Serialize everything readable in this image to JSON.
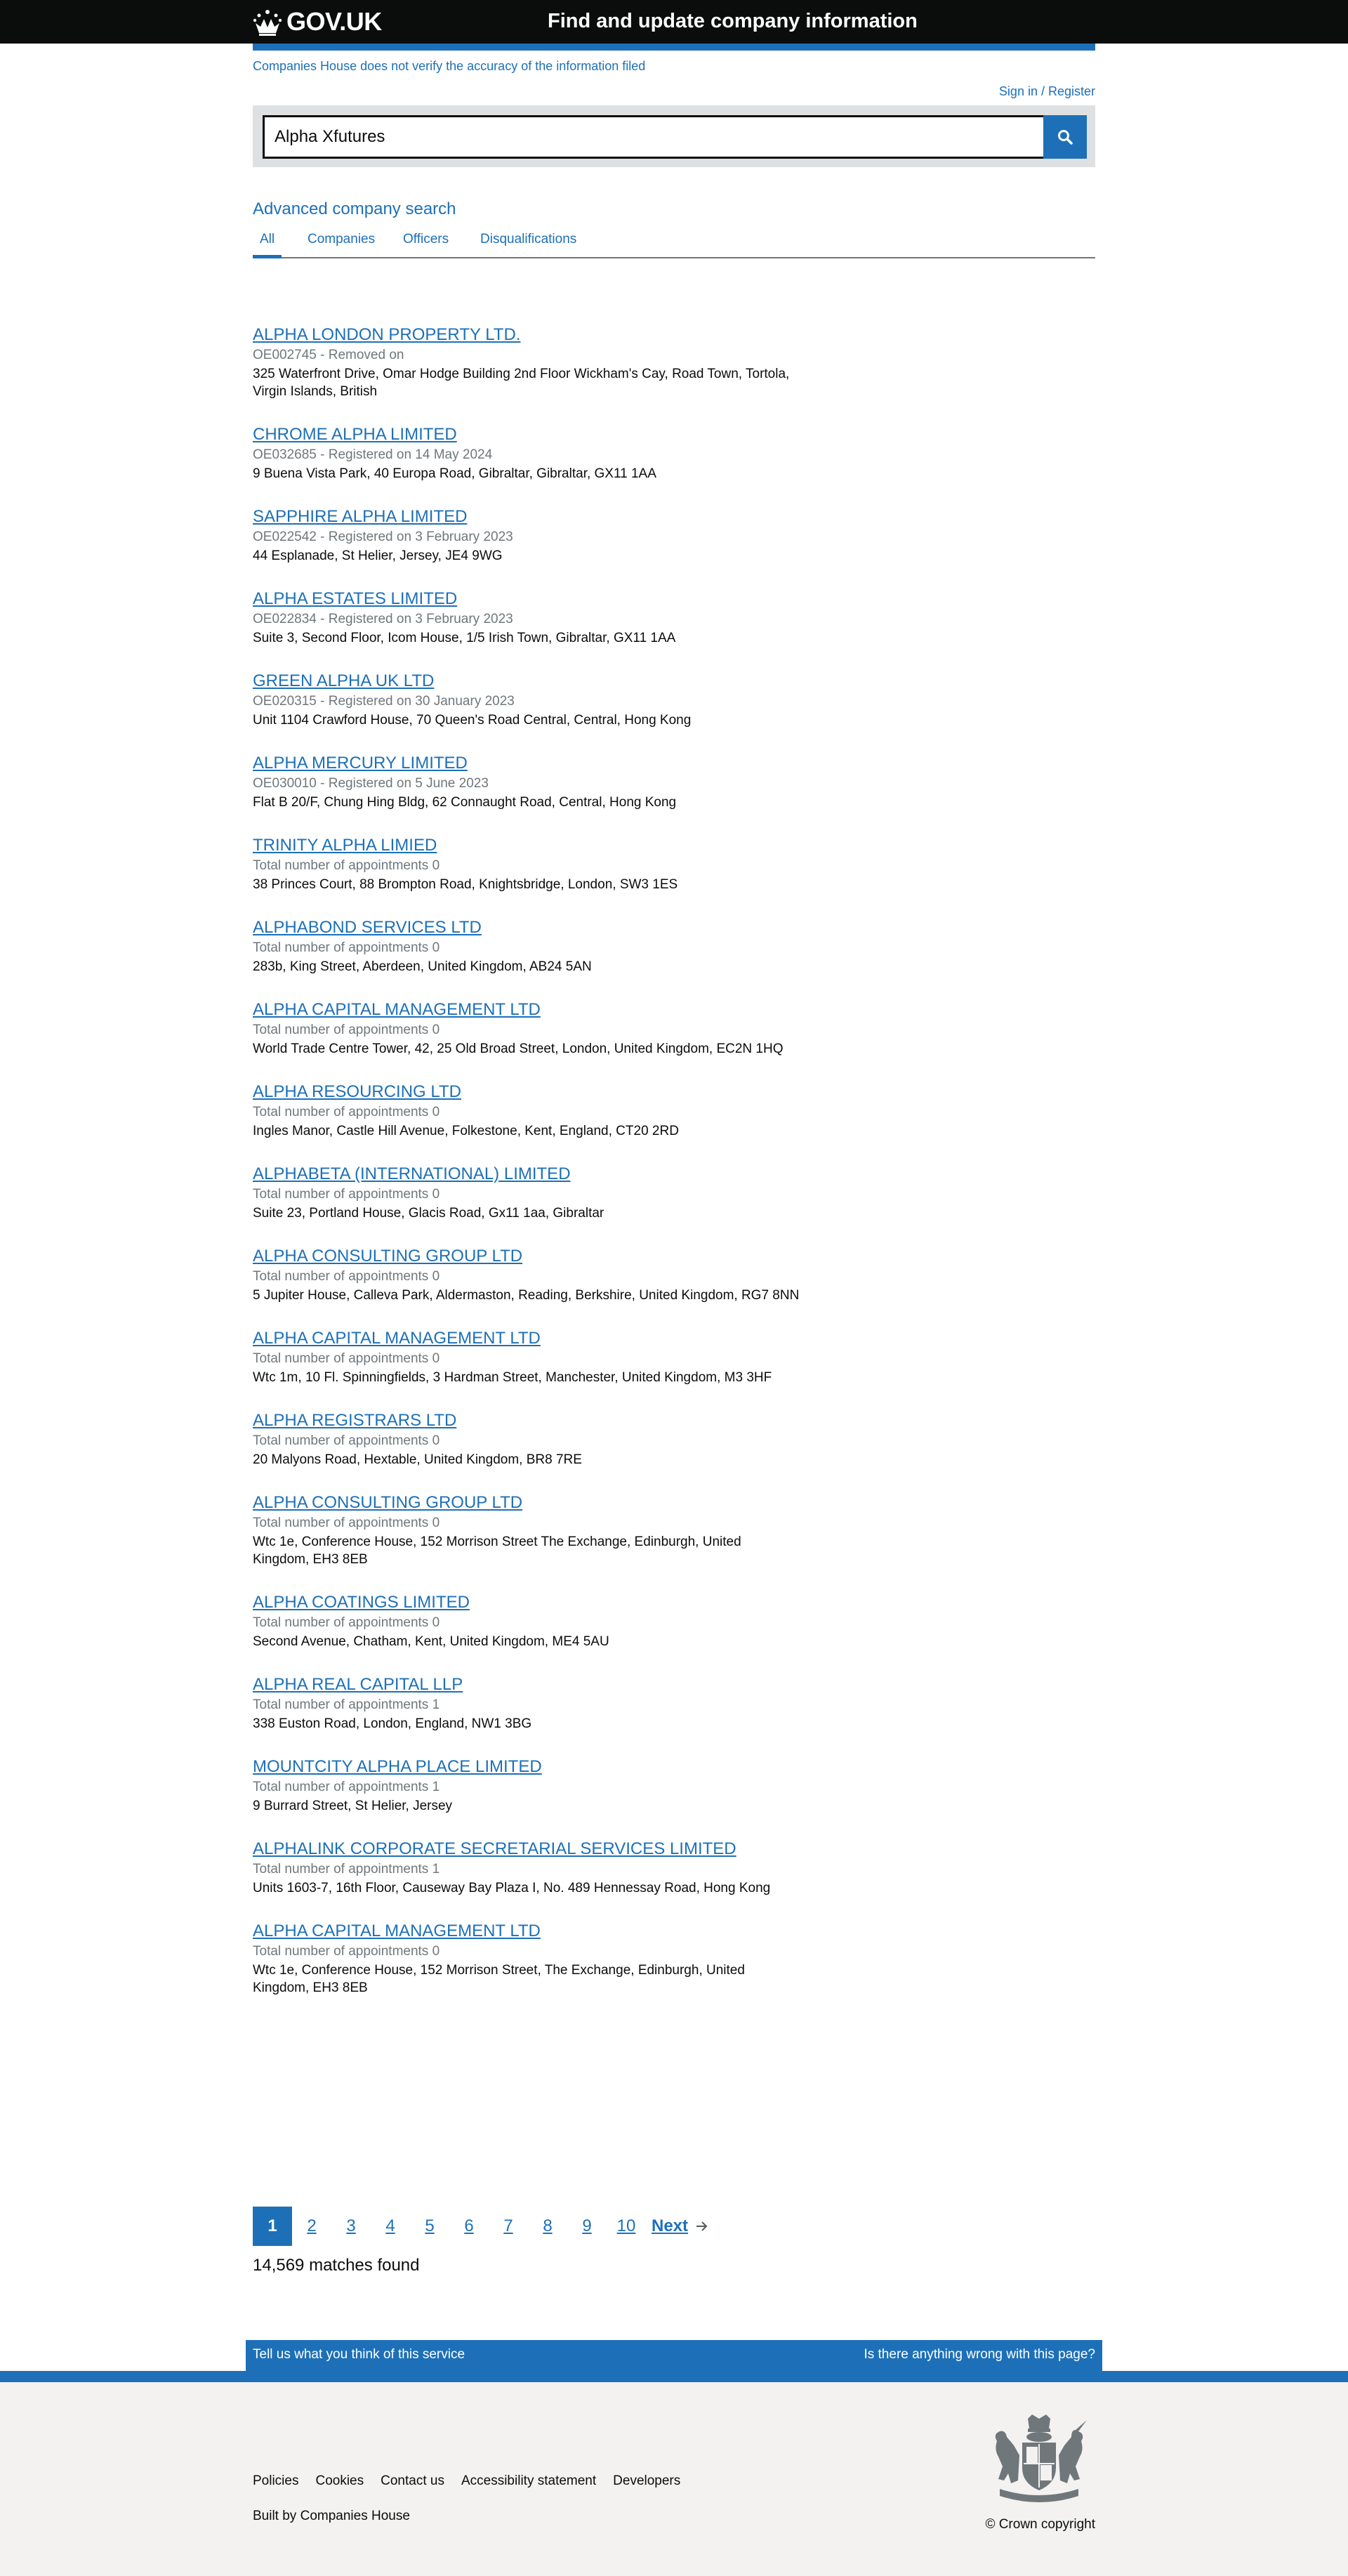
{
  "header": {
    "logo_text": "GOV.UK",
    "service_name": "Find and update company information"
  },
  "notice": {
    "disclaimer": "Companies House does not verify the accuracy of the information filed",
    "signin": "Sign in / Register"
  },
  "search": {
    "value": "Alpha Xfutures",
    "advanced_link": "Advanced company search"
  },
  "tabs": [
    {
      "label": "All",
      "active": true
    },
    {
      "label": "Companies",
      "active": false
    },
    {
      "label": "Officers",
      "active": false
    },
    {
      "label": "Disqualifications",
      "active": false
    }
  ],
  "results": [
    {
      "title": "ALPHA LONDON PROPERTY LTD.",
      "meta": "OE002745 - Removed on",
      "address": "325 Waterfront Drive, Omar Hodge Building 2nd Floor Wickham's Cay, Road Town, Tortola, Virgin Islands, British"
    },
    {
      "title": "CHROME ALPHA LIMITED",
      "meta": "OE032685 - Registered on 14 May 2024",
      "address": "9 Buena Vista Park, 40 Europa Road, Gibraltar, Gibraltar, GX11 1AA"
    },
    {
      "title": "SAPPHIRE ALPHA LIMITED",
      "meta": "OE022542 - Registered on 3 February 2023",
      "address": "44 Esplanade, St Helier, Jersey, JE4 9WG"
    },
    {
      "title": "ALPHA ESTATES LIMITED",
      "meta": "OE022834 - Registered on 3 February 2023",
      "address": "Suite 3, Second Floor, Icom House, 1/5 Irish Town, Gibraltar, GX11 1AA"
    },
    {
      "title": "GREEN ALPHA UK LTD",
      "meta": "OE020315 - Registered on 30 January 2023",
      "address": "Unit 1104 Crawford House, 70 Queen's Road Central, Central, Hong Kong"
    },
    {
      "title": "ALPHA MERCURY LIMITED",
      "meta": "OE030010 - Registered on 5 June 2023",
      "address": "Flat B 20/F, Chung Hing Bldg, 62 Connaught Road, Central, Hong Kong"
    },
    {
      "title": "TRINITY ALPHA LIMIED",
      "meta": "Total number of appointments 0",
      "address": "38 Princes Court, 88 Brompton Road, Knightsbridge, London, SW3 1ES"
    },
    {
      "title": "ALPHABOND SERVICES LTD",
      "meta": "Total number of appointments 0",
      "address": "283b, King Street, Aberdeen, United Kingdom, AB24 5AN"
    },
    {
      "title": "ALPHA CAPITAL MANAGEMENT LTD",
      "meta": "Total number of appointments 0",
      "address": "World Trade Centre Tower, 42, 25 Old Broad Street, London, United Kingdom, EC2N 1HQ"
    },
    {
      "title": "ALPHA RESOURCING LTD",
      "meta": "Total number of appointments 0",
      "address": "Ingles Manor, Castle Hill Avenue, Folkestone, Kent, England, CT20 2RD"
    },
    {
      "title": "ALPHABETA (INTERNATIONAL) LIMITED",
      "meta": "Total number of appointments 0",
      "address": "Suite 23, Portland House, Glacis Road, Gx11 1aa, Gibraltar"
    },
    {
      "title": "ALPHA CONSULTING GROUP LTD",
      "meta": "Total number of appointments 0",
      "address": "5 Jupiter House, Calleva Park, Aldermaston, Reading, Berkshire, United Kingdom, RG7 8NN"
    },
    {
      "title": "ALPHA CAPITAL MANAGEMENT LTD",
      "meta": "Total number of appointments 0",
      "address": "Wtc 1m, 10 Fl. Spinningfields, 3 Hardman Street, Manchester, United Kingdom, M3 3HF"
    },
    {
      "title": "ALPHA REGISTRARS LTD",
      "meta": "Total number of appointments 0",
      "address": "20 Malyons Road, Hextable, United Kingdom, BR8 7RE"
    },
    {
      "title": "ALPHA CONSULTING GROUP LTD",
      "meta": "Total number of appointments 0",
      "address": "Wtc 1e, Conference House, 152 Morrison Street The Exchange, Edinburgh, United Kingdom, EH3 8EB"
    },
    {
      "title": "ALPHA COATINGS LIMITED",
      "meta": "Total number of appointments 0",
      "address": "Second Avenue, Chatham, Kent, United Kingdom, ME4 5AU"
    },
    {
      "title": "ALPHA REAL CAPITAL LLP",
      "meta": "Total number of appointments 1",
      "address": "338 Euston Road, London, England, NW1 3BG"
    },
    {
      "title": "MOUNTCITY ALPHA PLACE LIMITED",
      "meta": "Total number of appointments 1",
      "address": "9 Burrard Street, St Helier, Jersey"
    },
    {
      "title": "ALPHALINK CORPORATE SECRETARIAL SERVICES LIMITED",
      "meta": "Total number of appointments 1",
      "address": "Units 1603-7, 16th Floor, Causeway Bay Plaza I, No. 489 Hennessay Road, Hong Kong"
    },
    {
      "title": "ALPHA CAPITAL MANAGEMENT LTD",
      "meta": "Total number of appointments 0",
      "address": "Wtc 1e, Conference House, 152 Morrison Street, The Exchange, Edinburgh, United Kingdom, EH3 8EB"
    }
  ],
  "pagination": {
    "pages": [
      "1",
      "2",
      "3",
      "4",
      "5",
      "6",
      "7",
      "8",
      "9",
      "10"
    ],
    "current": "1",
    "next_label": "Next",
    "matches": "14,569 matches found"
  },
  "feedback": {
    "left": "Tell us what you think of this service",
    "right": "Is there anything wrong with this page?"
  },
  "footer": {
    "links": [
      "Policies",
      "Cookies",
      "Contact us",
      "Accessibility statement",
      "Developers"
    ],
    "built_by_prefix": "Built by ",
    "built_by_link": "Companies House",
    "copyright": "© Crown copyright"
  },
  "colors": {
    "link": "#1d70b8",
    "header_bg": "#0b0c0c",
    "footer_bg": "#f3f2f1",
    "meta_text": "#6f777b"
  }
}
